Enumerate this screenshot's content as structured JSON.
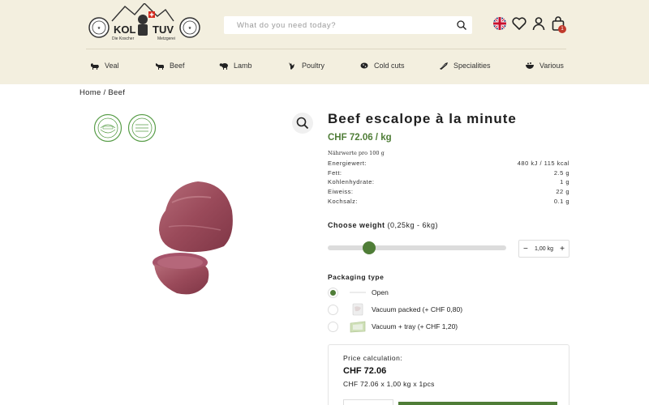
{
  "header": {
    "logo_text": "KOL TUV",
    "logo_sub_left": "Die Koscher",
    "logo_sub_right": "Metzgerei",
    "search_placeholder": "What do you need today?",
    "cart_count": "1"
  },
  "nav": {
    "items": [
      {
        "label": "Veal",
        "icon": "calf-icon"
      },
      {
        "label": "Beef",
        "icon": "cow-icon"
      },
      {
        "label": "Lamb",
        "icon": "lamb-icon"
      },
      {
        "label": "Poultry",
        "icon": "chicken-icon"
      },
      {
        "label": "Cold cuts",
        "icon": "sausage-icon"
      },
      {
        "label": "Specialities",
        "icon": "knife-icon"
      },
      {
        "label": "Various",
        "icon": "bowl-icon"
      }
    ]
  },
  "breadcrumb": {
    "home": "Home",
    "separator": "/",
    "current": "Beef"
  },
  "product": {
    "title": "Beef escalope à la minute",
    "price": "CHF 72.06 / kg",
    "nutrition_heading": "Nährwerte pro 100 g",
    "nutrition": [
      {
        "label": "Energiewert:",
        "value": "480 kJ / 115 kcal"
      },
      {
        "label": "Fett:",
        "value": "2.5 g"
      },
      {
        "label": "Kohlenhydrate:",
        "value": "1 g"
      },
      {
        "label": "Eiweiss:",
        "value": "22 g"
      },
      {
        "label": "Kochsalz:",
        "value": "0.1 g"
      }
    ],
    "weight": {
      "label": "Choose weight",
      "range": "(0,25kg - 6kg)",
      "value": "1,00 kg",
      "slider_fraction": 0.13,
      "minus": "−",
      "plus": "+"
    },
    "packaging": {
      "label": "Packaging type",
      "options": [
        {
          "label": "Open",
          "selected": true
        },
        {
          "label": "Vacuum packed (+ CHF 0,80)",
          "selected": false
        },
        {
          "label": "Vacuum + tray (+ CHF 1,20)",
          "selected": false
        }
      ]
    },
    "calc": {
      "label": "Price calculation:",
      "total": "CHF 72.06",
      "formula": "CHF 72.06 x 1,00 kg x 1pcs"
    }
  },
  "colors": {
    "brand_green": "#4f7d37",
    "header_bg": "#f3efdf",
    "badge_red": "#c0392b"
  }
}
